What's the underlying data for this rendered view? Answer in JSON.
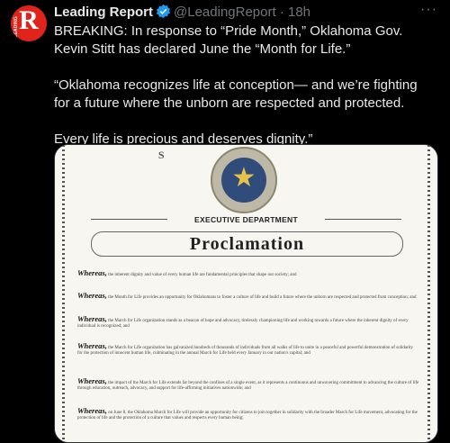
{
  "post": {
    "author_name": "Leading Report",
    "handle": "@LeadingReport",
    "separator": "·",
    "time": "18h",
    "more_label": "···",
    "avatar_letter": "R",
    "avatar_side_text": "LEADING",
    "paragraphs": [
      "BREAKING: In response to “Pride Month,” Oklahoma Gov. Kevin Stitt has declared June the “Month for Life.”",
      "“Oklahoma recognizes life at conception— and we’re fighting for a future where the unborn are respected and protected.",
      "Every life is precious and deserves dignity.”"
    ]
  },
  "document": {
    "seal_text": "SA",
    "department": "EXECUTIVE DEPARTMENT",
    "title": "Proclamation",
    "whereas": [
      {
        "lead": "Whereas,",
        "text": "the inherent dignity and value of every human life are fundamental principles that shape our society; and"
      },
      {
        "lead": "Whereas,",
        "text": "the Month for Life provides an opportunity for Oklahomans to foster a culture of life and build a future where the unborn are respected and protected from conception; and"
      },
      {
        "lead": "Whereas,",
        "text": "the March for Life organization stands as a beacon of hope and advocacy, tirelessly championing life and working towards a future where the inherent dignity of every individual is recognized; and"
      },
      {
        "lead": "Whereas,",
        "text": "the March for Life organization has galvanized hundreds of thousands of individuals from all walks of life to unite in a peaceful and powerful demonstration of solidarity for the protection of innocent human life, culminating in the annual March for Life held every January in our nation's capital; and"
      },
      {
        "lead": "Whereas,",
        "text": "the impact of the March for Life extends far beyond the confines of a single event, as it represents a continuous and unwavering commitment to advancing the culture of life through education, outreach, advocacy, and support for life-affirming initiatives nationwide; and"
      },
      {
        "lead": "Whereas,",
        "text": "on June 8, the Oklahoma March for Life will provide an opportunity for citizens to join together in solidarity with the broader March for Life movement, advocating for the protection of life and the protection of a culture that values and respects every human being;"
      }
    ]
  }
}
